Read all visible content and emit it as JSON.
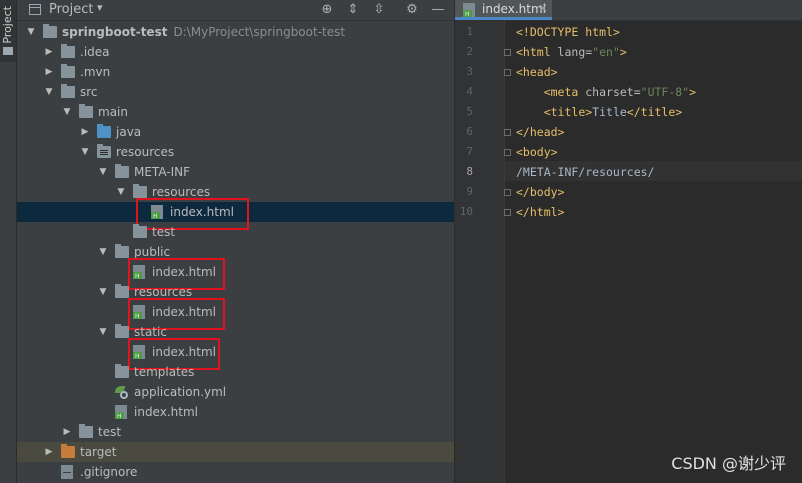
{
  "sidebar_strip": {
    "label": "Project"
  },
  "project_panel": {
    "title": "Project",
    "toolbar_icons": [
      "crosshair-icon",
      "expand-all-icon",
      "collapse-all-icon",
      "settings-icon",
      "hide-icon"
    ]
  },
  "tree": [
    {
      "label": "springboot-test",
      "path": "D:\\MyProject\\springboot-test",
      "depth": 0,
      "arrow": "down",
      "icon": "module-folder"
    },
    {
      "label": ".idea",
      "depth": 1,
      "arrow": "right",
      "icon": "folder"
    },
    {
      "label": ".mvn",
      "depth": 1,
      "arrow": "right",
      "icon": "folder"
    },
    {
      "label": "src",
      "depth": 1,
      "arrow": "down",
      "icon": "folder"
    },
    {
      "label": "main",
      "depth": 2,
      "arrow": "down",
      "icon": "folder"
    },
    {
      "label": "java",
      "depth": 3,
      "arrow": "right",
      "icon": "source-folder"
    },
    {
      "label": "resources",
      "depth": 3,
      "arrow": "down",
      "icon": "resources-folder"
    },
    {
      "label": "META-INF",
      "depth": 4,
      "arrow": "down",
      "icon": "folder"
    },
    {
      "label": "resources",
      "depth": 5,
      "arrow": "down",
      "icon": "folder"
    },
    {
      "label": "index.html",
      "depth": 6,
      "arrow": "",
      "icon": "html-file",
      "selected": true
    },
    {
      "label": "test",
      "depth": 5,
      "arrow": "",
      "icon": "folder"
    },
    {
      "label": "public",
      "depth": 4,
      "arrow": "down",
      "icon": "folder"
    },
    {
      "label": "index.html",
      "depth": 5,
      "arrow": "",
      "icon": "html-file"
    },
    {
      "label": "resources",
      "depth": 4,
      "arrow": "down",
      "icon": "folder"
    },
    {
      "label": "index.html",
      "depth": 5,
      "arrow": "",
      "icon": "html-file"
    },
    {
      "label": "static",
      "depth": 4,
      "arrow": "down",
      "icon": "folder"
    },
    {
      "label": "index.html",
      "depth": 5,
      "arrow": "",
      "icon": "html-file"
    },
    {
      "label": "templates",
      "depth": 4,
      "arrow": "",
      "icon": "folder"
    },
    {
      "label": "application.yml",
      "depth": 4,
      "arrow": "",
      "icon": "yml-file"
    },
    {
      "label": "index.html",
      "depth": 4,
      "arrow": "",
      "icon": "html-file"
    },
    {
      "label": "test",
      "depth": 2,
      "arrow": "right",
      "icon": "folder"
    },
    {
      "label": "target",
      "depth": 1,
      "arrow": "right",
      "icon": "excluded-folder",
      "excluded": true
    },
    {
      "label": ".gitignore",
      "depth": 1,
      "arrow": "",
      "icon": "gitignore-file"
    }
  ],
  "editor": {
    "tab_label": "index.html",
    "current_line": 8,
    "lines": [
      {
        "n": "1",
        "parts": [
          [
            "tag",
            "<!DOCTYPE html>"
          ]
        ]
      },
      {
        "n": "2",
        "parts": [
          [
            "tag",
            "<html "
          ],
          [
            "attr",
            "lang="
          ],
          [
            "val",
            "\"en\""
          ],
          [
            "tag",
            ">"
          ]
        ]
      },
      {
        "n": "3",
        "parts": [
          [
            "tag",
            "<head>"
          ]
        ]
      },
      {
        "n": "4",
        "parts": [
          [
            "txt",
            "    "
          ],
          [
            "tag",
            "<meta "
          ],
          [
            "attr",
            "charset="
          ],
          [
            "val",
            "\"UTF-8\""
          ],
          [
            "tag",
            ">"
          ]
        ]
      },
      {
        "n": "5",
        "parts": [
          [
            "txt",
            "    "
          ],
          [
            "tag",
            "<title>"
          ],
          [
            "txt",
            "Title"
          ],
          [
            "tag",
            "</title>"
          ]
        ]
      },
      {
        "n": "6",
        "parts": [
          [
            "tag",
            "</head>"
          ]
        ]
      },
      {
        "n": "7",
        "parts": [
          [
            "tag",
            "<body>"
          ]
        ]
      },
      {
        "n": "8",
        "parts": [
          [
            "txt",
            "/META-INF/resources/"
          ]
        ]
      },
      {
        "n": "9",
        "parts": [
          [
            "tag",
            "</body>"
          ]
        ]
      },
      {
        "n": "10",
        "parts": [
          [
            "tag",
            "</html>"
          ]
        ]
      }
    ]
  },
  "watermark": "CSDN @谢少评",
  "colors": {
    "highlight_box": "#e0141e",
    "selection": "#0d293e",
    "tag": "#e8bf6a",
    "value": "#6a8759",
    "text": "#a9b7c6"
  }
}
